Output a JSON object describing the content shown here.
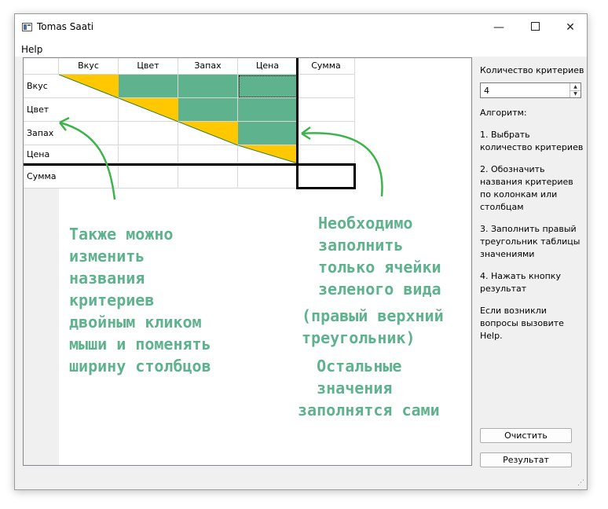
{
  "window": {
    "title": "Tomas Saati"
  },
  "controls": {
    "minimize": "—",
    "close": "✕"
  },
  "menu": {
    "help": "Help"
  },
  "table": {
    "columns": [
      "Вкус",
      "Цвет",
      "Запах",
      "Цена",
      "Сумма"
    ],
    "rows": [
      "Вкус",
      "Цвет",
      "Запах",
      "Цена",
      "Сумма"
    ]
  },
  "annotations": {
    "left": "Также можно\nизменить\nназвания\nкритериев\nдвойным кликом\nмыши и поменять\nширину столбцов",
    "right1": "Необходимо\nзаполнить\nтолько ячейки\nзеленого вида",
    "right2": "(правый верхний\nтреугольник)",
    "right3": "  Остальные\n  значения\nзаполнятся сами"
  },
  "sidebar": {
    "count_label": "Количество критериев",
    "count_value": "4",
    "algorithm_label": "Алгоритм:",
    "step1": "1. Выбрать количество критериев",
    "step2": "2. Обозначить названия критериев по колонкам или столбцам",
    "step3": "3. Заполнить правый треугольник таблицы значениями",
    "step4": "4. Нажать кнопку результат",
    "help_note": "Если возникли вопросы вызовите Help.",
    "clear_button": "Очистить",
    "result_button": "Результат"
  },
  "colors": {
    "green": "#5fb28e",
    "yellow": "#ffc800",
    "annotation": "#5fb28e"
  },
  "icons": {
    "app": "app-window-icon",
    "resize": "resize-grip-icon"
  }
}
